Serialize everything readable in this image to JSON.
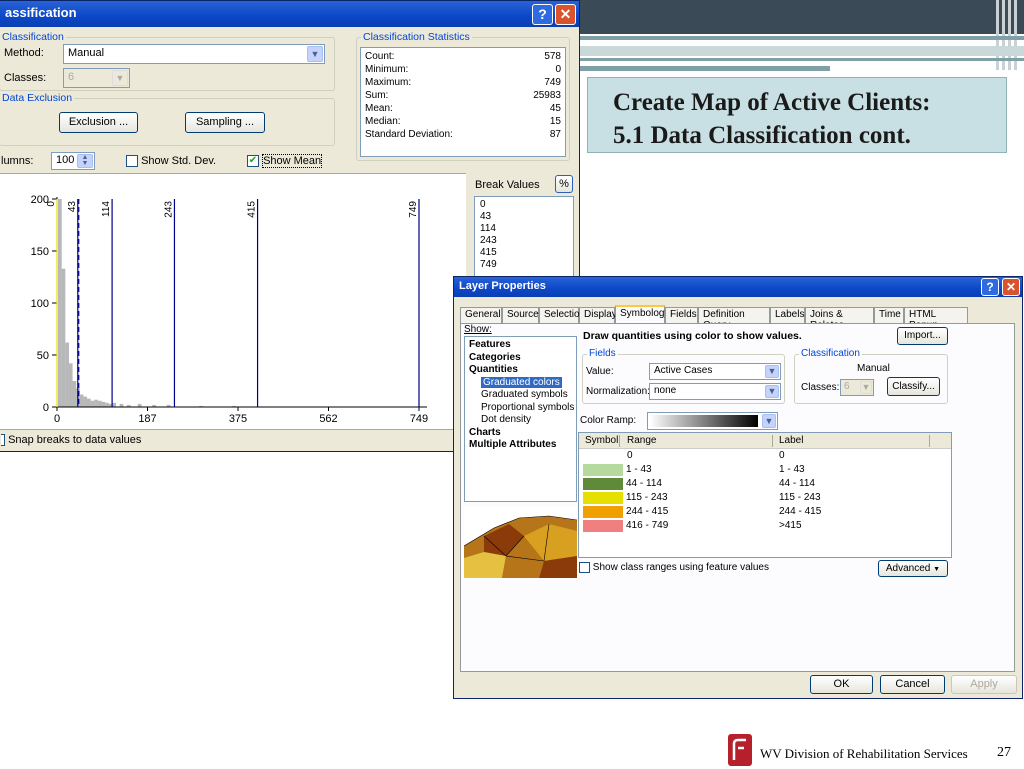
{
  "slide": {
    "title_line1": "Create Map of Active Clients:",
    "title_line2": "5.1 Data Classification cont.",
    "footer": "WV Division of Rehabilitation Services",
    "page_number": "27"
  },
  "classification": {
    "title": "assification",
    "classification_group": "Classification",
    "method_label": "Method:",
    "method_value": "Manual",
    "classes_label": "Classes:",
    "classes_value": "6",
    "data_exclusion_group": "Data Exclusion",
    "exclusion_button": "Exclusion ...",
    "sampling_button": "Sampling ...",
    "columns_label": "lumns:",
    "columns_value": "100",
    "show_std_dev": "Show Std. Dev.",
    "show_mean": "Show Mean",
    "snap_label": "Snap breaks to data values",
    "stats": {
      "group": "Classification Statistics",
      "rows": [
        {
          "label": "Count:",
          "value": "578"
        },
        {
          "label": "Minimum:",
          "value": "0"
        },
        {
          "label": "Maximum:",
          "value": "749"
        },
        {
          "label": "Sum:",
          "value": "25983"
        },
        {
          "label": "Mean:",
          "value": "45"
        },
        {
          "label": "Median:",
          "value": "15"
        },
        {
          "label": "Standard Deviation:",
          "value": "87"
        }
      ]
    },
    "break_values_label": "Break Values",
    "percent_button": "%",
    "break_values": [
      "0",
      "43",
      "114",
      "243",
      "415",
      "749"
    ]
  },
  "chart_data": {
    "type": "bar",
    "title": "",
    "xlabel": "",
    "ylabel": "",
    "xlim": [
      0,
      749
    ],
    "ylim": [
      0,
      200
    ],
    "x_ticks": [
      "0",
      "187",
      "375",
      "562",
      "749"
    ],
    "y_ticks": [
      "0",
      "50",
      "100",
      "150",
      "200"
    ],
    "break_lines": [
      0,
      43,
      114,
      243,
      415,
      749
    ],
    "break_labels": [
      "0",
      "43",
      "114",
      "243",
      "415",
      "749"
    ],
    "mean": 45,
    "bins": [
      {
        "x": 0,
        "count": 200
      },
      {
        "x": 7.5,
        "count": 133
      },
      {
        "x": 15,
        "count": 62
      },
      {
        "x": 22.5,
        "count": 42
      },
      {
        "x": 30,
        "count": 25
      },
      {
        "x": 37.5,
        "count": 18
      },
      {
        "x": 45,
        "count": 12
      },
      {
        "x": 52.5,
        "count": 10
      },
      {
        "x": 60,
        "count": 8
      },
      {
        "x": 67.5,
        "count": 6
      },
      {
        "x": 75,
        "count": 7
      },
      {
        "x": 82.5,
        "count": 6
      },
      {
        "x": 90,
        "count": 5
      },
      {
        "x": 97.5,
        "count": 4
      },
      {
        "x": 105,
        "count": 3
      },
      {
        "x": 112.5,
        "count": 4
      },
      {
        "x": 127.5,
        "count": 3
      },
      {
        "x": 142.5,
        "count": 2
      },
      {
        "x": 165,
        "count": 3
      },
      {
        "x": 195,
        "count": 2
      },
      {
        "x": 225,
        "count": 2
      },
      {
        "x": 292,
        "count": 1
      },
      {
        "x": 360,
        "count": 1
      }
    ]
  },
  "layer_properties": {
    "title": "Layer Properties",
    "tabs": [
      "General",
      "Source",
      "Selection",
      "Display",
      "Symbology",
      "Fields",
      "Definition Query",
      "Labels",
      "Joins & Relates",
      "Time",
      "HTML Popup"
    ],
    "selected_tab": "Symbology",
    "show_label": "Show:",
    "tree": [
      {
        "label": "Features",
        "level": 0,
        "bold": true
      },
      {
        "label": "Categories",
        "level": 0,
        "bold": true
      },
      {
        "label": "Quantities",
        "level": 0,
        "bold": true
      },
      {
        "label": "Graduated colors",
        "level": 1,
        "selected": true
      },
      {
        "label": "Graduated symbols",
        "level": 1
      },
      {
        "label": "Proportional symbols",
        "level": 1
      },
      {
        "label": "Dot density",
        "level": 1
      },
      {
        "label": "Charts",
        "level": 0,
        "bold": true
      },
      {
        "label": "Multiple Attributes",
        "level": 0,
        "bold": true
      }
    ],
    "heading": "Draw quantities using color to show values.",
    "import_button": "Import...",
    "fields_group": "Fields",
    "value_label": "Value:",
    "value": "Active Cases",
    "normalization_label": "Normalization:",
    "normalization": "none",
    "classification_group": "Classification",
    "classification_method": "Manual",
    "classes_label": "Classes:",
    "classes_value": "6",
    "classify_button": "Classify...",
    "color_ramp_label": "Color Ramp:",
    "columns": [
      "Symbol",
      "Range",
      "Label"
    ],
    "rows": [
      {
        "color": "#ffffff",
        "range": "0",
        "label": "0"
      },
      {
        "color": "#b6d99d",
        "range": "1 - 43",
        "label": "1 - 43"
      },
      {
        "color": "#5e8a3a",
        "range": "44 - 114",
        "label": "44 - 114"
      },
      {
        "color": "#e6e000",
        "range": "115 - 243",
        "label": "115 - 243"
      },
      {
        "color": "#f0a000",
        "range": "244 - 415",
        "label": "244 - 415"
      },
      {
        "color": "#f08080",
        "range": "416 - 749",
        "label": ">415"
      }
    ],
    "show_class_ranges": "Show class ranges using feature values",
    "advanced_button": "Advanced",
    "ok_button": "OK",
    "cancel_button": "Cancel",
    "apply_button": "Apply"
  }
}
